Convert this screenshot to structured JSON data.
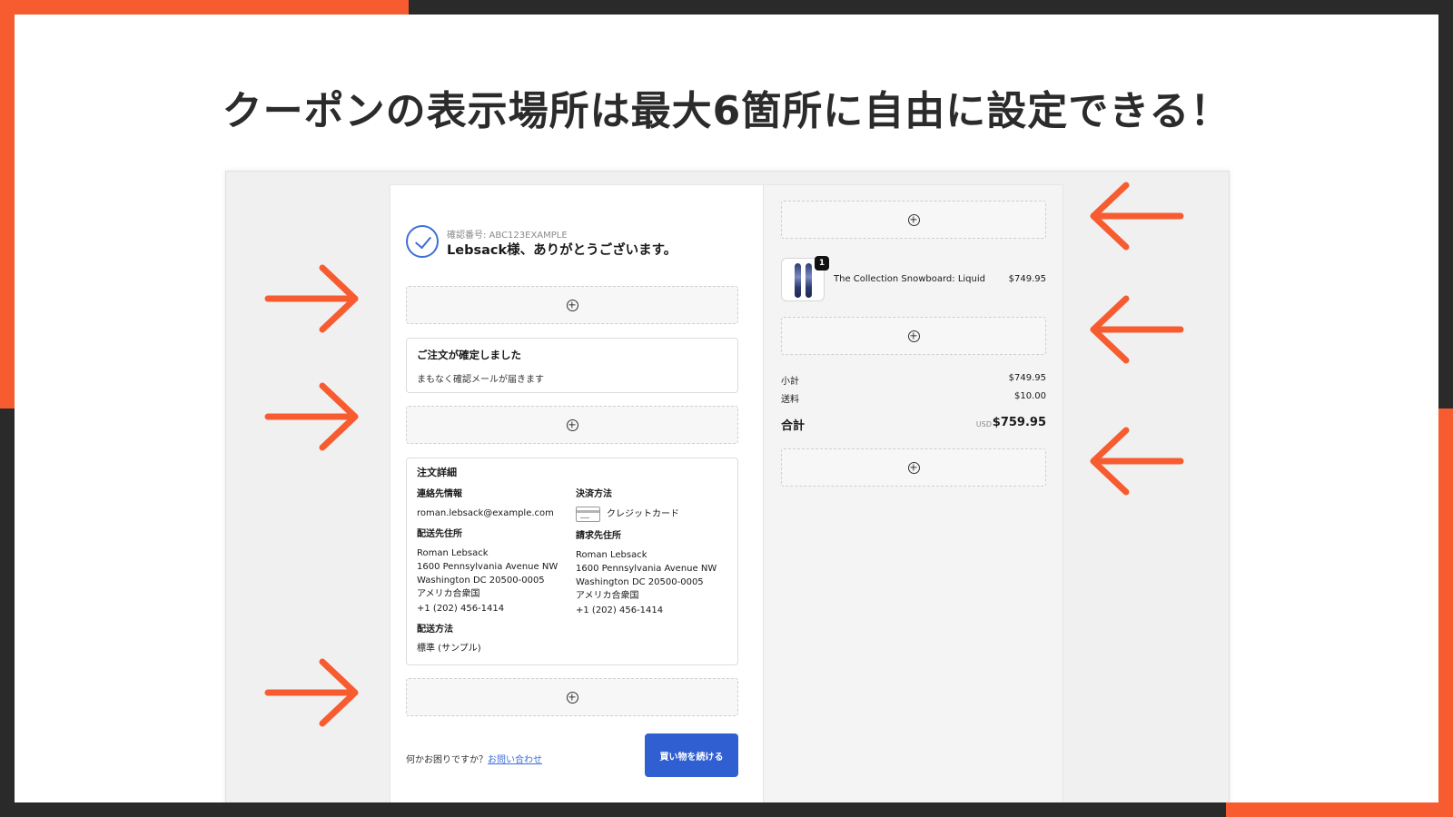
{
  "headline": "クーポンの表示場所は最大6箇所に自由に設定できる！",
  "colors": {
    "accent": "#F75C30",
    "dark": "#2a2a2a",
    "button": "#2f5fd1",
    "link": "#3d6fd6"
  },
  "icons": {
    "slot": "add-circle-icon",
    "arrow": "arrow-icon",
    "status": "check-circle-icon",
    "payment": "credit-card-icon"
  },
  "header": {
    "confirmation_number": "確認番号: ABC123EXAMPLE",
    "thanks": "Lebsack様、ありがとうございます。"
  },
  "confirm_card": {
    "title": "ご注文が確定しました",
    "subtitle": "まもなく確認メールが届きます"
  },
  "details": {
    "title": "注文詳細",
    "contact_label": "連絡先情報",
    "contact_email": "roman.lebsack@example.com",
    "shipping_address_label": "配送先住所",
    "shipping_address": [
      "Roman Lebsack",
      "1600 Pennsylvania Avenue NW",
      "Washington DC 20500-0005",
      "アメリカ合衆国",
      "+1 (202) 456-1414"
    ],
    "shipping_method_label": "配送方法",
    "shipping_method": "標準 (サンプル)",
    "payment_label": "決済方法",
    "payment_method": "クレジットカード",
    "billing_address_label": "請求先住所",
    "billing_address": [
      "Roman Lebsack",
      "1600 Pennsylvania Avenue NW",
      "Washington DC 20500-0005",
      "アメリカ合衆国",
      "+1 (202) 456-1414"
    ]
  },
  "footer": {
    "help_text": "何かお困りですか？",
    "help_link": "お問い合わせ",
    "continue_button": "買い物を続ける"
  },
  "order_summary": {
    "item": {
      "quantity": "1",
      "name": "The Collection Snowboard: Liquid",
      "price": "$749.95"
    },
    "subtotal_label": "小計",
    "subtotal": "$749.95",
    "shipping_label": "送料",
    "shipping": "$10.00",
    "total_label": "合計",
    "currency": "USD",
    "total": "$759.95"
  }
}
